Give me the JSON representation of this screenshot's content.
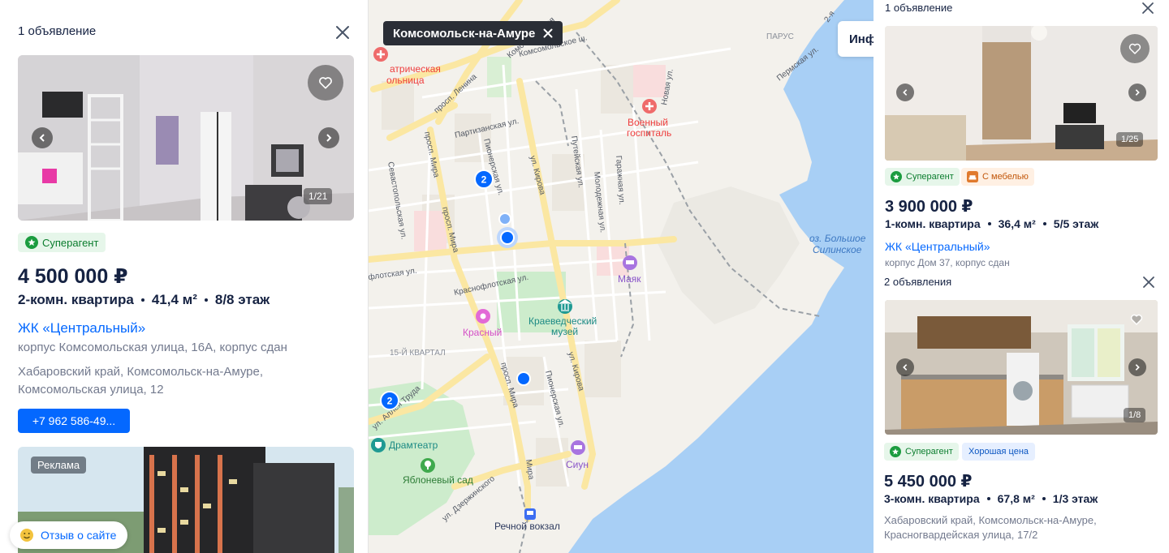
{
  "left_card": {
    "count_label": "1 объявление",
    "photo_counter": "1/21",
    "badge_super": "Суперагент",
    "price": "4 500 000 ₽",
    "rooms": "2-комн. квартира",
    "area": "41,4 м²",
    "floor": "8/8 этаж",
    "complex_link": "ЖК «Центральный»",
    "building": "корпус Комсомольская улица, 16А, корпус сдан",
    "address_line1": "Хабаровский край, Комсомольск-на-Амуре,",
    "address_line2": "Комсомольская улица, 12",
    "phone": "+7 962 586-49..."
  },
  "ad": {
    "label": "Реклама"
  },
  "feedback": {
    "label": "Отзыв о сайте"
  },
  "map": {
    "city_chip": "Комсомольск-на-Амуре",
    "info_tab": "Инфр",
    "cluster_counts": [
      "2",
      "2"
    ],
    "labels": {
      "hospital_pediatric_1": "атрическая",
      "hospital_pediatric_2": "ольница",
      "military_hospital_1": "Военный",
      "military_hospital_2": "госпиталь",
      "lake_1": "оз. Большое",
      "lake_2": "Силинское",
      "mayak": "Маяк",
      "museum_1": "Краеведческий",
      "museum_2": "музей",
      "krasny": "Красный",
      "quarter15": "15-Й КВАРТАЛ",
      "drama": "Драмтеатр",
      "garden": "Яблоневый сад",
      "siun": "Сиун",
      "river_station": "Речной вокзал",
      "parus": "ПАРУС",
      "prosp_lenina": "просп. Ленина",
      "partizanskaya": "Партизанская ул.",
      "pionerskaya_top": "Пионерская ул.",
      "kirova_top": "ул. Кирова",
      "putevskaya": "Путейская ул.",
      "molodezhnaya": "Молодежная ул.",
      "garazhnaya": "Гаражная ул.",
      "sevastopolskaya": "Севастопольская ул.",
      "prosp_mira_top": "просп. Мира",
      "prosp_mira_left": "просп. Мира",
      "krasnoflotskaya": "Краснофлотская ул.",
      "flotskaya": "флотская ул.",
      "prosp_mira_bottom": "просп. Мира",
      "pionerskaya_bottom": "Пионерская ул.",
      "kirova_bottom": "ул. Кирова",
      "alleya_truda": "ул. Аллея Труда",
      "dzerzhinskogo": "ул. Дзержинского",
      "mira_small": "Мира",
      "novaya": "Новая ул.",
      "permskaya": "Пермская ул.",
      "komsomolskaya": "Комсомольская",
      "komsomolskoe_sh": "Комсомольское ш.",
      "yaya": "2-я"
    }
  },
  "right_cards": [
    {
      "count_label": "1 объявление",
      "photo_counter": "1/25",
      "badge_super": "Суперагент",
      "badge_extra": "С мебелью",
      "price": "3 900 000 ₽",
      "rooms": "1-комн. квартира",
      "area": "36,4 м²",
      "floor": "5/5 этаж",
      "complex_link": "ЖК «Центральный»",
      "building": "корпус Дом 37, корпус сдан"
    },
    {
      "count_label": "2 объявления",
      "photo_counter": "1/8",
      "badge_super": "Суперагент",
      "badge_extra": "Хорошая цена",
      "price": "5 450 000 ₽",
      "rooms": "3-комн. квартира",
      "area": "67,8 м²",
      "floor": "1/3 этаж",
      "address_line1": "Хабаровский край, Комсомольск-на-Амуре,",
      "address_line2": "Красногвардейская улица, 17/2"
    }
  ],
  "icons": [
    "close-icon",
    "heart-icon",
    "chevron-left-icon",
    "chevron-right-icon",
    "star-badge-icon",
    "sofa-icon",
    "smile-icon",
    "hospital-icon",
    "museum-icon",
    "hotel-icon",
    "cinema-icon",
    "theatre-icon",
    "park-icon",
    "bus-station-icon"
  ],
  "colors": {
    "accent_blue": "#0468ff",
    "text": "#152242",
    "secondary_text": "#737a8e",
    "super_green": "#0b7d2e",
    "water": "#a8cff5",
    "road": "#fbe7a2",
    "park": "#cdeccc"
  }
}
